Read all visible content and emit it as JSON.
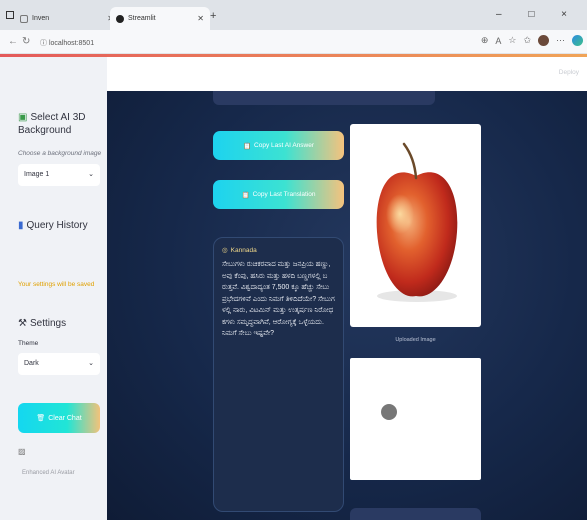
{
  "browser": {
    "tabs": [
      {
        "label": "Inven",
        "active": false
      },
      {
        "label": "Streamlit",
        "active": true
      }
    ],
    "new_tab": "+",
    "url": "localhost:8501",
    "window_controls": "– □ ×"
  },
  "sidebar": {
    "background_heading": "Select AI 3D Background",
    "background_caption": "Choose a background image",
    "background_select_value": "Image 1",
    "query_history": "Query History",
    "warning": "Your settings will be saved",
    "settings_heading": "Settings",
    "theme_label": "Theme",
    "theme_select_value": "Dark",
    "clear_chat": "Clear Chat",
    "image_caption": "Enhanced AI Avatar"
  },
  "main": {
    "deploy": "Deploy",
    "copy_answer": "Copy Last AI Answer",
    "copy_translation": "Copy Last Translation",
    "answer_language": "Kannada",
    "answer_text": "ಸೇಬುಗಳು ರುಚಿಕರವಾದ ಮತ್ತು ಜನಪ್ರಿಯ ಹಣ್ಣು, ಅವು ಕೆಂಪು, ಹಸಿರು ಮತ್ತು ಹಳದಿ ಬಣ್ಣಗಳಲ್ಲಿ ಬರುತ್ತವೆ. ವಿಶ್ವದಾದ್ಯಂತ 7,500 ಕ್ಕೂ ಹೆಚ್ಚು ಸೇಬು ಪ್ರಭೇದಗಳಿವೆ ಎಂದು ನಿಮಗೆ ತಿಳಿದಿದೆಯೇ? ಸೇಬುಗಳಲ್ಲಿ ನಾರು, ವಿಟಮಿನ್ ಮತ್ತು ಉತ್ಕರ್ಷಣ ನಿರೋಧಕಗಳು ಸಮೃದ್ಧವಾಗಿವೆ, ಆರೋಗ್ಯಕ್ಕೆ ಒಳ್ಳೆಯದು. ನಿಮಗೆ ಸೇಬು ಇಷ್ಟವೇ?",
    "image_caption": "Uploaded Image"
  },
  "colors": {
    "accent_gradient_start": "#1dd3ef",
    "accent_gradient_end": "#f5c27d",
    "main_background": "#16284a",
    "sidebar_background": "#f0f2f6"
  }
}
